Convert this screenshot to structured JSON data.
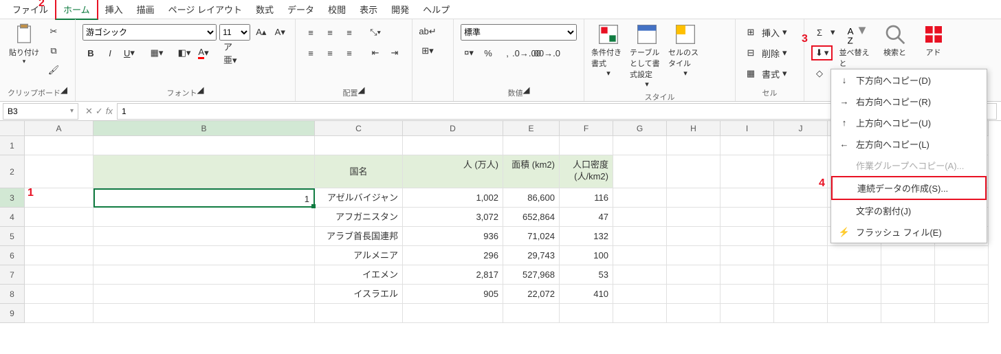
{
  "tabs": [
    "ファイル",
    "ホーム",
    "挿入",
    "描画",
    "ページ レイアウト",
    "数式",
    "データ",
    "校閲",
    "表示",
    "開発",
    "ヘルプ"
  ],
  "active_tab": 1,
  "callouts": {
    "tab": "2",
    "cell": "1",
    "fillbtn": "3",
    "fillseries": "4"
  },
  "groups": {
    "clipboard": {
      "label": "クリップボード",
      "paste": "貼り付け"
    },
    "font": {
      "label": "フォント",
      "name": "游ゴシック",
      "size": "11"
    },
    "align": {
      "label": "配置"
    },
    "number": {
      "label": "数値",
      "format": "標準"
    },
    "styles": {
      "label": "スタイル",
      "cond": "条件付き書式",
      "table": "テーブルとして書式設定",
      "cell": "セルのスタイル"
    },
    "cells": {
      "label": "セル",
      "insert": "挿入",
      "delete": "削除",
      "format": "書式"
    },
    "editing": {
      "sort": "並べ替えと",
      "find": "検索と",
      "addin": "アド"
    }
  },
  "namebox": "B3",
  "formula": "1",
  "columns": [
    "A",
    "B",
    "C",
    "D",
    "E",
    "F",
    "G",
    "H",
    "I",
    "J",
    "K",
    "L",
    "M"
  ],
  "header_row": {
    "B": "",
    "C": "国名",
    "D": "人\n(万人)",
    "E": "面積\n(km2)",
    "F": "人口密度\n(人/km2)"
  },
  "data_rows": [
    {
      "B": "1",
      "C": "アゼルバイジャン",
      "D": "1,002",
      "E": "86,600",
      "F": "116"
    },
    {
      "B": "",
      "C": "アフガニスタン",
      "D": "3,072",
      "E": "652,864",
      "F": "47"
    },
    {
      "B": "",
      "C": "アラブ首長国連邦",
      "D": "936",
      "E": "71,024",
      "F": "132"
    },
    {
      "B": "",
      "C": "アルメニア",
      "D": "296",
      "E": "29,743",
      "F": "100"
    },
    {
      "B": "",
      "C": "イエメン",
      "D": "2,817",
      "E": "527,968",
      "F": "53"
    },
    {
      "B": "",
      "C": "イスラエル",
      "D": "905",
      "E": "22,072",
      "F": "410"
    }
  ],
  "fill_menu": {
    "down": "下方向へコピー(D)",
    "right": "右方向へコピー(R)",
    "up": "上方向へコピー(U)",
    "left": "左方向へコピー(L)",
    "group": "作業グループへコピー(A)...",
    "series": "連続データの作成(S)...",
    "justify": "文字の割付(J)",
    "flash": "フラッシュ フィル(E)"
  }
}
